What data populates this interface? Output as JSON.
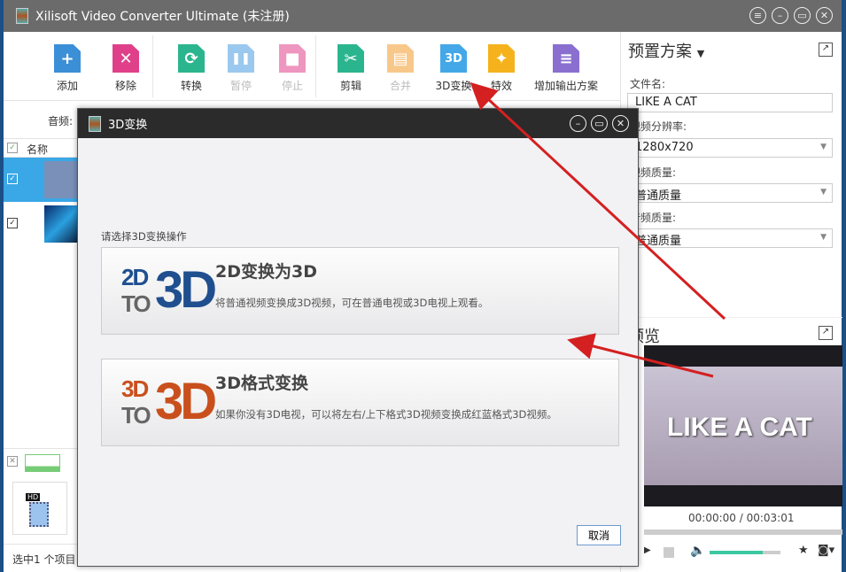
{
  "app": {
    "title": "Xilisoft Video Converter Ultimate (未注册)",
    "window_controls": [
      "menu-icon",
      "minimize-icon",
      "maximize-icon",
      "close-icon"
    ]
  },
  "toolbar": {
    "items": [
      {
        "label": "添加",
        "icon": "add-icon",
        "color": "#3b8fd6",
        "glyph": "+",
        "enabled": true
      },
      {
        "label": "移除",
        "icon": "remove-icon",
        "color": "#e0408a",
        "glyph": "✕",
        "enabled": true
      },
      {
        "label": "转换",
        "icon": "convert-icon",
        "color": "#2bb58e",
        "glyph": "⟳",
        "enabled": true
      },
      {
        "label": "暂停",
        "icon": "pause-icon",
        "color": "#4a9be0",
        "glyph": "❚❚",
        "enabled": false
      },
      {
        "label": "停止",
        "icon": "stop-icon",
        "color": "#e0408a",
        "glyph": "■",
        "enabled": false
      },
      {
        "label": "剪辑",
        "icon": "scissors-icon",
        "color": "#2bb58e",
        "glyph": "✂",
        "enabled": true
      },
      {
        "label": "合并",
        "icon": "merge-icon",
        "color": "#f39c2a",
        "glyph": "▤",
        "enabled": false
      },
      {
        "label": "3D变换",
        "icon": "3d-icon",
        "color": "#44a8e8",
        "glyph": "3D",
        "enabled": true
      },
      {
        "label": "特效",
        "icon": "effects-icon",
        "color": "#f5b21c",
        "glyph": "✦",
        "enabled": true
      },
      {
        "label": "增加输出方案",
        "icon": "add-profile-icon",
        "color": "#8a6fd0",
        "glyph": "≡",
        "enabled": true
      }
    ]
  },
  "left": {
    "audio_label": "音频:",
    "column_name": "名称",
    "status": "选中1 个项目"
  },
  "right": {
    "preset_title": "预置方案",
    "filename_label": "文件名:",
    "filename_value": "LIKE A CAT",
    "resolution_label": "视频分辨率:",
    "resolution_value": "1280x720",
    "video_quality_label": "视频质量:",
    "video_quality_value": "普通质量",
    "audio_quality_label": "音频质量:",
    "audio_quality_value": "普通质量",
    "preview_title": "预览",
    "video_caption": "LIKE A CAT",
    "time": "00:00:00 / 00:03:01",
    "volume": 0.75
  },
  "dialog": {
    "title": "3D变换",
    "prompt": "请选择3D变换操作",
    "options": [
      {
        "title": "2D变换为3D",
        "desc": "将普通视频变换成3D视频，可在普通电视或3D电视上观看。",
        "logo_top": "2D",
        "logo_bottom": "TO",
        "logo_big": "3D",
        "color": "#1f4f8f"
      },
      {
        "title": "3D格式变换",
        "desc": "如果你没有3D电视，可以将左右/上下格式3D视频变换成红蓝格式3D视频。",
        "logo_top": "3D",
        "logo_bottom": "TO",
        "logo_big": "3D",
        "color": "#c9501c"
      }
    ],
    "cancel": "取消"
  },
  "annotation_color": "#d42020"
}
